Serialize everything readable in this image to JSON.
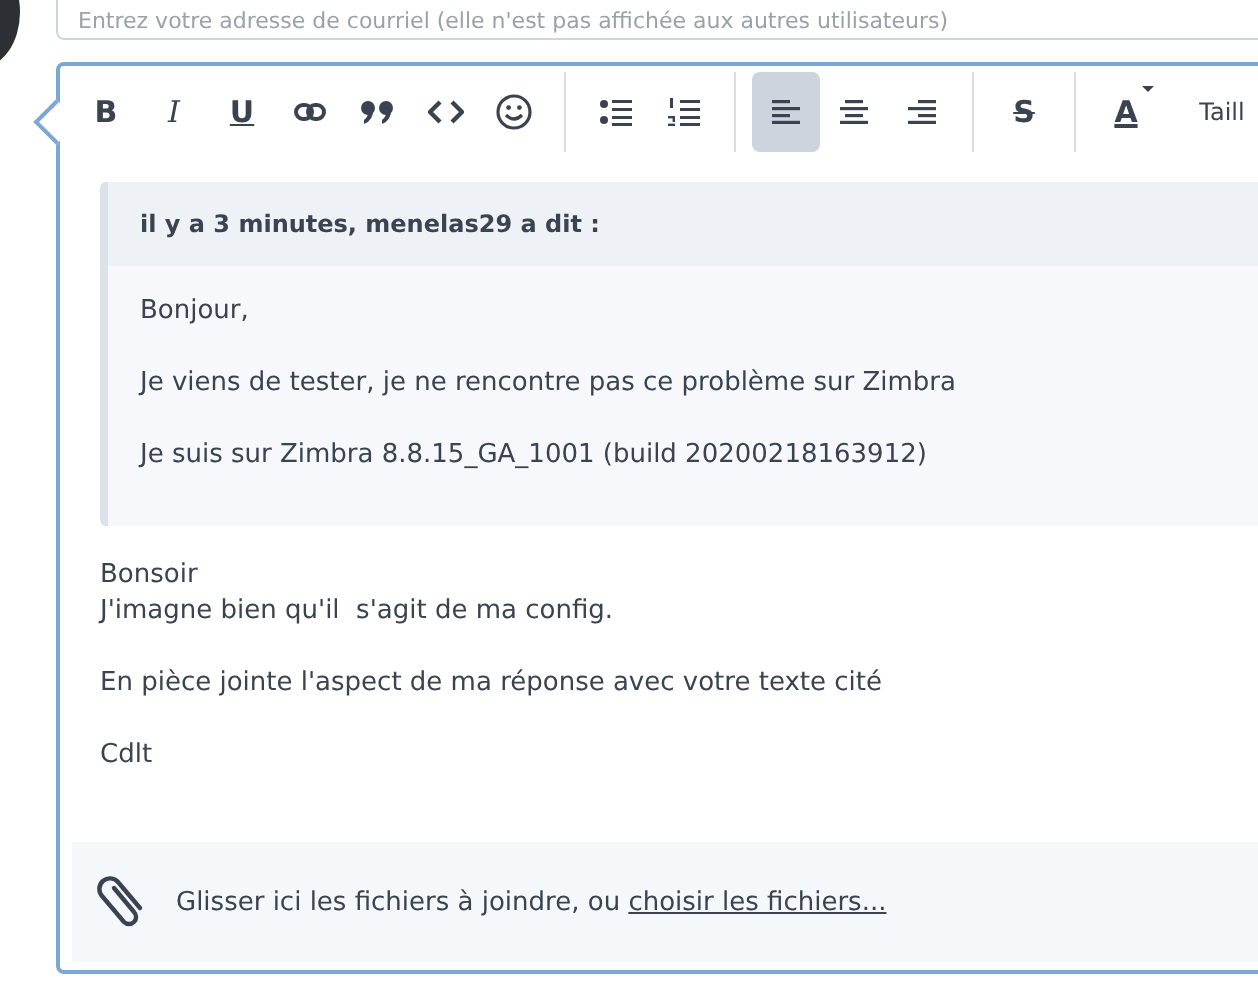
{
  "email_field": {
    "placeholder": "Entrez votre adresse de courriel (elle n'est pas affichée aux autres utilisateurs)"
  },
  "toolbar": {
    "groups": [
      [
        {
          "kind": "bold",
          "label": "B",
          "selected": false
        },
        {
          "kind": "italic",
          "label": "I",
          "selected": false
        },
        {
          "kind": "underline",
          "label": "U",
          "selected": false
        },
        {
          "kind": "link",
          "selected": false
        },
        {
          "kind": "quote",
          "selected": false
        },
        {
          "kind": "code",
          "selected": false
        },
        {
          "kind": "smiley",
          "selected": false
        }
      ],
      [
        {
          "kind": "bullets",
          "selected": false
        },
        {
          "kind": "numbers",
          "selected": false
        }
      ],
      [
        {
          "kind": "left",
          "selected": true
        },
        {
          "kind": "center",
          "selected": false
        },
        {
          "kind": "right",
          "selected": false
        }
      ],
      [
        {
          "kind": "strike",
          "label": "S",
          "selected": false
        }
      ],
      [
        {
          "kind": "color",
          "label": "A",
          "selected": false
        },
        {
          "kind": "size",
          "label": "Taill",
          "selected": false
        }
      ]
    ]
  },
  "quote": {
    "header": "il y a 3 minutes, menelas29 a dit :",
    "paragraphs": [
      "Bonjour,",
      "Je viens de tester, je ne rencontre pas ce problème sur Zimbra",
      "Je suis sur Zimbra 8.8.15_GA_1001 (build 20200218163912)"
    ]
  },
  "body": {
    "paragraphs": [
      [
        "Bonsoir",
        "J'imagne bien qu'il  s'agit de ma config."
      ],
      [
        "En pièce jointe l'aspect de ma réponse avec votre texte cité"
      ],
      [
        "Cdlt"
      ]
    ]
  },
  "attachments": {
    "text": "Glisser ici les fichiers à joindre, ou ",
    "link": "choisir les fichiers..."
  }
}
